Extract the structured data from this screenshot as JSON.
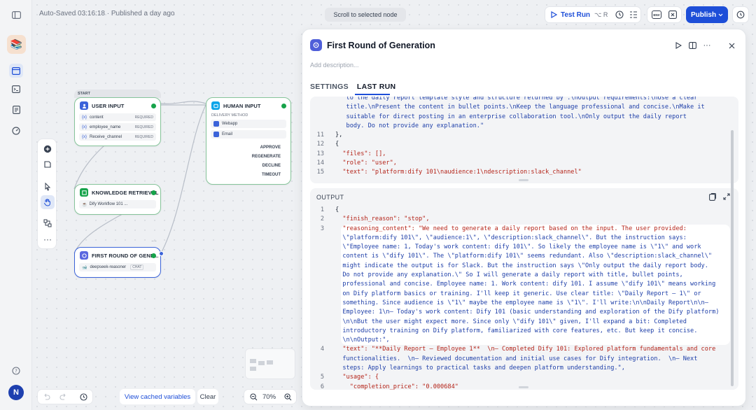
{
  "topbar": {
    "status": "Auto-Saved 03:16:18 · Published a day ago",
    "scroll_button": "Scroll to selected node",
    "test_run": "Test Run",
    "test_run_shortcut": "⌥ R",
    "env_label": "ENV",
    "publish": "Publish"
  },
  "nodes": {
    "start_label": "START",
    "user_input": {
      "title": "USER INPUT",
      "fields": [
        {
          "prefix": "{x}",
          "name": "content",
          "req": "REQUIRED"
        },
        {
          "prefix": "{x}",
          "name": "employee_name",
          "req": "REQUIRED"
        },
        {
          "prefix": "{x}",
          "name": "Receive_channel",
          "req": "REQUIRED"
        }
      ]
    },
    "knowledge": {
      "title": "KNOWLEDGE RETRIEVAL",
      "item": "Dify Workflow 101 ..."
    },
    "generation": {
      "title": "FIRST ROUND OF GENE...",
      "model": "deepseek-reasoner",
      "mode": "CHAT"
    },
    "human_input": {
      "title": "HUMAN INPUT",
      "method_label": "DELIVERY METHOD",
      "methods": [
        "Webapp",
        "Email"
      ],
      "actions": [
        "APPROVE",
        "REGENERATE",
        "DECLINE",
        "TIMEOUT"
      ]
    }
  },
  "bottom": {
    "view_cached": "View cached variables",
    "clear": "Clear",
    "zoom": "70%"
  },
  "panel": {
    "title": "First Round of Generation",
    "description_placeholder": "Add description...",
    "tabs": [
      "SETTINGS",
      "LAST RUN"
    ],
    "input_code": [
      {
        "n": "",
        "t": "   to the daily report template style and structure returned by .\\nOutput requirements:\\nUse a clear"
      },
      {
        "n": "",
        "t": "   title.\\nPresent the content in bullet points.\\nKeep the language professional and concise.\\nMake it"
      },
      {
        "n": "",
        "t": "   suitable for direct posting in an enterprise collaboration tool.\\nOnly output the daily report"
      },
      {
        "n": "",
        "t": "   body. Do not provide any explanation.\""
      },
      {
        "n": "11",
        "t": "},"
      },
      {
        "n": "12",
        "t": "{"
      },
      {
        "n": "13",
        "t": "  \"files\": [],"
      },
      {
        "n": "14",
        "t": "  \"role\": \"user\","
      },
      {
        "n": "15",
        "t": "  \"text\": \"platform:dify 101\\naudience:1\\ndescription:slack_channel\""
      }
    ],
    "output_label": "OUTPUT",
    "output_code": [
      {
        "n": "1",
        "t": "{"
      },
      {
        "n": "2",
        "t": "  \"finish_reason\": \"stop\","
      },
      {
        "n": "3",
        "t": "  \"reasoning_content\": \"We need to generate a daily report based on the input. The user provided:"
      },
      {
        "n": "",
        "t": "  \\\"platform:dify 101\\\", \\\"audience:1\\\", \\\"description:slack_channel\\\". But the instruction says:"
      },
      {
        "n": "",
        "t": "  \\\"Employee name: 1, Today's work content: dify 101\\\". So likely the employee name is \\\"1\\\" and work"
      },
      {
        "n": "",
        "t": "  content is \\\"dify 101\\\". The \\\"platform:dify 101\\\" seems redundant. Also \\\"description:slack_channel\\\""
      },
      {
        "n": "",
        "t": "  might indicate the output is for Slack. But the instruction says \\\"Only output the daily report body."
      },
      {
        "n": "",
        "t": "  Do not provide any explanation.\\\" So I will generate a daily report with title, bullet points,"
      },
      {
        "n": "",
        "t": "  professional and concise. Employee name: 1. Work content: dify 101. I assume \\\"dify 101\\\" means working"
      },
      {
        "n": "",
        "t": "  on Dify platform basics or training. I'll keep it generic. Use clear title: \\\"Daily Report – 1\\\" or"
      },
      {
        "n": "",
        "t": "  something. Since audience is \\\"1\\\" maybe the employee name is \\\"1\\\". I'll write:\\n\\nDaily Report\\n\\n–"
      },
      {
        "n": "",
        "t": "  Employee: 1\\n– Today's work content: Dify 101 (basic understanding and exploration of the Dify platform)"
      },
      {
        "n": "",
        "t": "  \\n\\nBut the user might expect more. Since only \\\"dify 101\\\" given, I'll expand a bit: Completed"
      },
      {
        "n": "",
        "t": "  introductory training on Dify platform, familiarized with core features, etc. But keep it concise."
      },
      {
        "n": "",
        "t": "  \\n\\nOutput:\","
      },
      {
        "n": "4",
        "t": "  \"text\": \"**Daily Report – Employee 1**  \\n– Completed Dify 101: Explored platform fundamentals and core"
      },
      {
        "n": "",
        "t": "  functionalities.  \\n– Reviewed documentation and initial use cases for Dify integration.  \\n– Next"
      },
      {
        "n": "",
        "t": "  steps: Apply learnings to practical tasks and deepen platform understanding.\","
      },
      {
        "n": "5",
        "t": "  \"usage\": {"
      },
      {
        "n": "6",
        "t": "    \"completion_price\": \"0.000684\""
      }
    ]
  }
}
